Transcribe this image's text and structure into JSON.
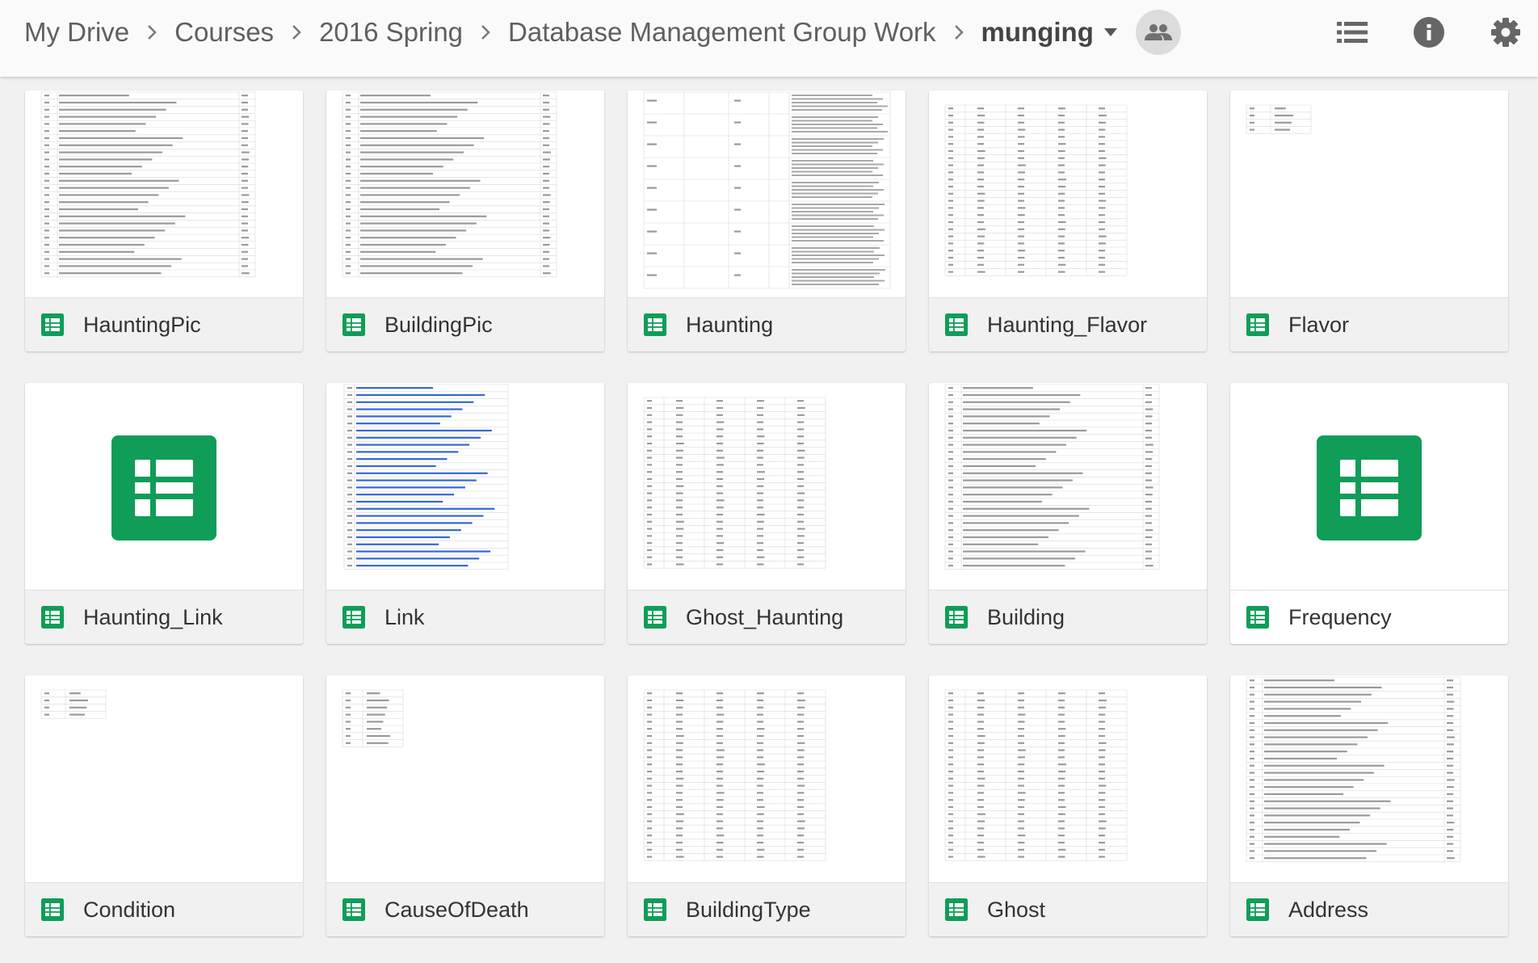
{
  "breadcrumb": [
    "My Drive",
    "Courses",
    "2016 Spring",
    "Database Management Group Work"
  ],
  "current_folder": "munging",
  "icons": {
    "separator": "chevron-right-icon",
    "folder_menu": "caret-down-icon",
    "share": "people-icon",
    "list_view": "list-view-icon",
    "details": "info-icon",
    "settings": "gear-icon",
    "file_type": "google-sheets-icon"
  },
  "colors": {
    "sheets_green": "#0F9D58",
    "selection": "#4A86E8",
    "link_blue": "#3367D6"
  },
  "files": [
    {
      "name": "HauntingPic",
      "preview": "wide"
    },
    {
      "name": "BuildingPic",
      "preview": "wide"
    },
    {
      "name": "Haunting",
      "preview": "text"
    },
    {
      "name": "Haunting_Flavor",
      "preview": "cols"
    },
    {
      "name": "Flavor",
      "preview": "mini"
    },
    {
      "name": "Haunting_Link",
      "preview": "icon"
    },
    {
      "name": "Link",
      "preview": "links"
    },
    {
      "name": "Ghost_Haunting",
      "preview": "cols"
    },
    {
      "name": "Building",
      "preview": "wide"
    },
    {
      "name": "Frequency",
      "preview": "icon",
      "selected": true
    },
    {
      "name": "Condition",
      "preview": "mini"
    },
    {
      "name": "CauseOfDeath",
      "preview": "short"
    },
    {
      "name": "BuildingType",
      "preview": "cols"
    },
    {
      "name": "Ghost",
      "preview": "cols"
    },
    {
      "name": "Address",
      "preview": "wide"
    }
  ]
}
